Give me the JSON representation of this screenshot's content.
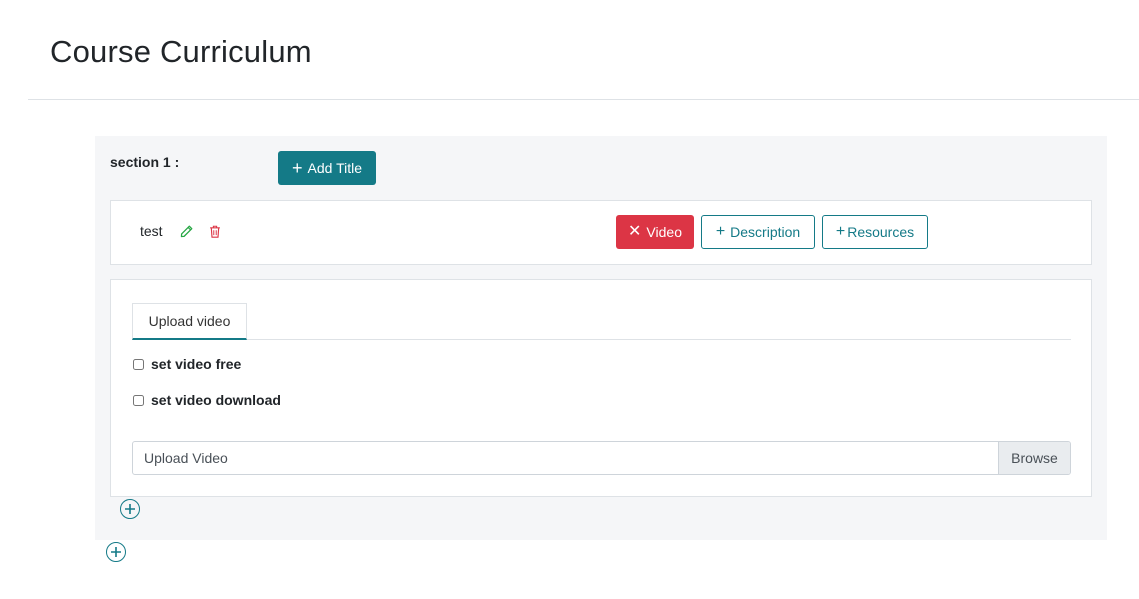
{
  "page": {
    "title": "Course Curriculum"
  },
  "section": {
    "label": "section 1 :",
    "add_title_label": "Add Title",
    "lecture": {
      "name": "test",
      "video_label": "Video",
      "description_label": "Description",
      "resources_label": "Resources"
    },
    "upload": {
      "tab_label": "Upload video",
      "free_label": "set video free",
      "download_label": "set video download",
      "file_placeholder": "Upload Video",
      "browse_label": "Browse"
    }
  },
  "colors": {
    "primary": "#147a87",
    "danger": "#dc3545"
  },
  "icons": {
    "edit": "pencil-icon",
    "delete": "trash-icon",
    "add": "plus-circle-icon",
    "close": "x-icon"
  }
}
